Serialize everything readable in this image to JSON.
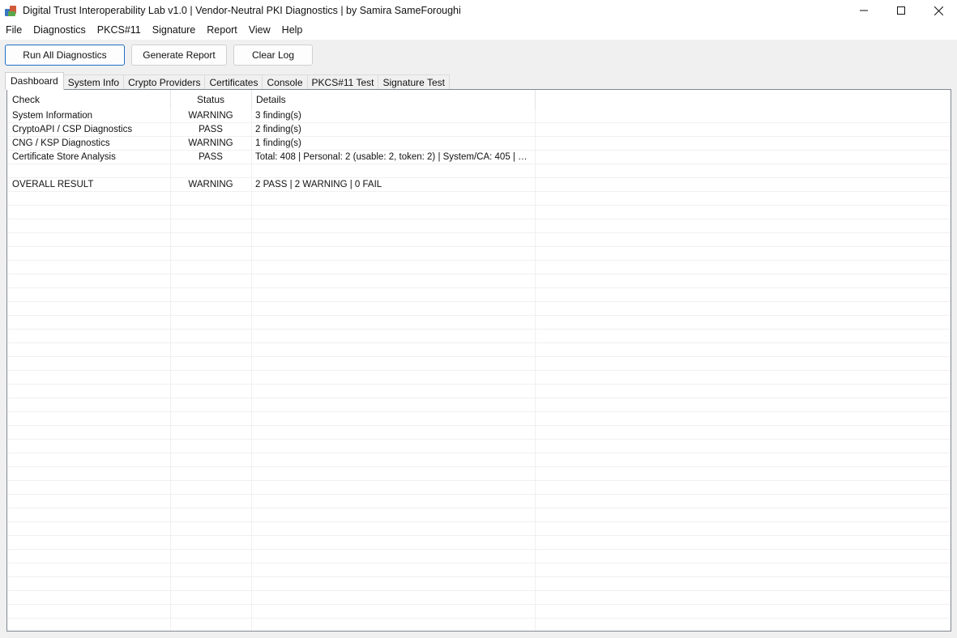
{
  "window": {
    "title": "Digital Trust Interoperability Lab v1.0  |  Vendor-Neutral PKI Diagnostics  |  by Samira SameForoughi",
    "app_icon": "pki-app-icon",
    "controls": [
      "minimize-icon",
      "maximize-icon",
      "close-icon"
    ]
  },
  "menu": [
    "File",
    "Diagnostics",
    "PKCS#11",
    "Signature",
    "Report",
    "View",
    "Help"
  ],
  "toolbar": {
    "run_all": "Run All Diagnostics",
    "generate_report": "Generate Report",
    "clear_log": "Clear Log"
  },
  "tabs": [
    "Dashboard",
    "System Info",
    "Crypto Providers",
    "Certificates",
    "Console",
    "PKCS#11 Test",
    "Signature Test"
  ],
  "table": {
    "columns": [
      "Check",
      "Status",
      "Details"
    ],
    "rows": [
      [
        "System Information",
        "WARNING",
        "3 finding(s)"
      ],
      [
        "CryptoAPI / CSP Diagnostics",
        "PASS",
        "2 finding(s)"
      ],
      [
        "CNG / KSP Diagnostics",
        "WARNING",
        "1 finding(s)"
      ],
      [
        "Certificate Store Analysis",
        "PASS",
        "Total: 408 | Personal: 2 (usable: 2, token: 2) | System/CA: 405 | Expire..."
      ],
      [
        "",
        "",
        ""
      ],
      [
        "OVERALL RESULT",
        "WARNING",
        "2 PASS  |  2 WARNING  |  0 FAIL"
      ]
    ]
  },
  "colors": {
    "accent_border": "#1f6fc5",
    "panel_border": "#828790",
    "background": "#f0f0f0"
  }
}
